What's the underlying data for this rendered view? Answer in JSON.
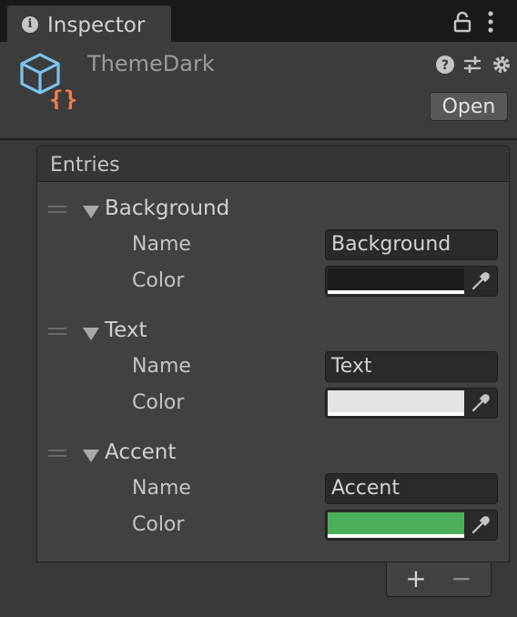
{
  "tab": {
    "title": "Inspector",
    "info_glyph": "i"
  },
  "header": {
    "asset_name": "ThemeDark",
    "open_label": "Open"
  },
  "list": {
    "header_label": "Entries",
    "entries": [
      {
        "title": "Background",
        "name_label": "Name",
        "name_value": "Background",
        "color_label": "Color",
        "color": "#1c1c1c"
      },
      {
        "title": "Text",
        "name_label": "Name",
        "name_value": "Text",
        "color_label": "Color",
        "color": "#e4e4e4"
      },
      {
        "title": "Accent",
        "name_label": "Name",
        "name_value": "Accent",
        "color_label": "Color",
        "color": "#4caf5a"
      }
    ]
  },
  "footer": {
    "add_label": "+",
    "remove_label": "−"
  },
  "icons": [
    "info-icon",
    "lock-icon",
    "kebab-menu-icon",
    "script-asset-icon",
    "help-icon",
    "sliders-icon",
    "gear-icon",
    "drag-handle-icon",
    "foldout-icon",
    "eyedropper-icon"
  ]
}
